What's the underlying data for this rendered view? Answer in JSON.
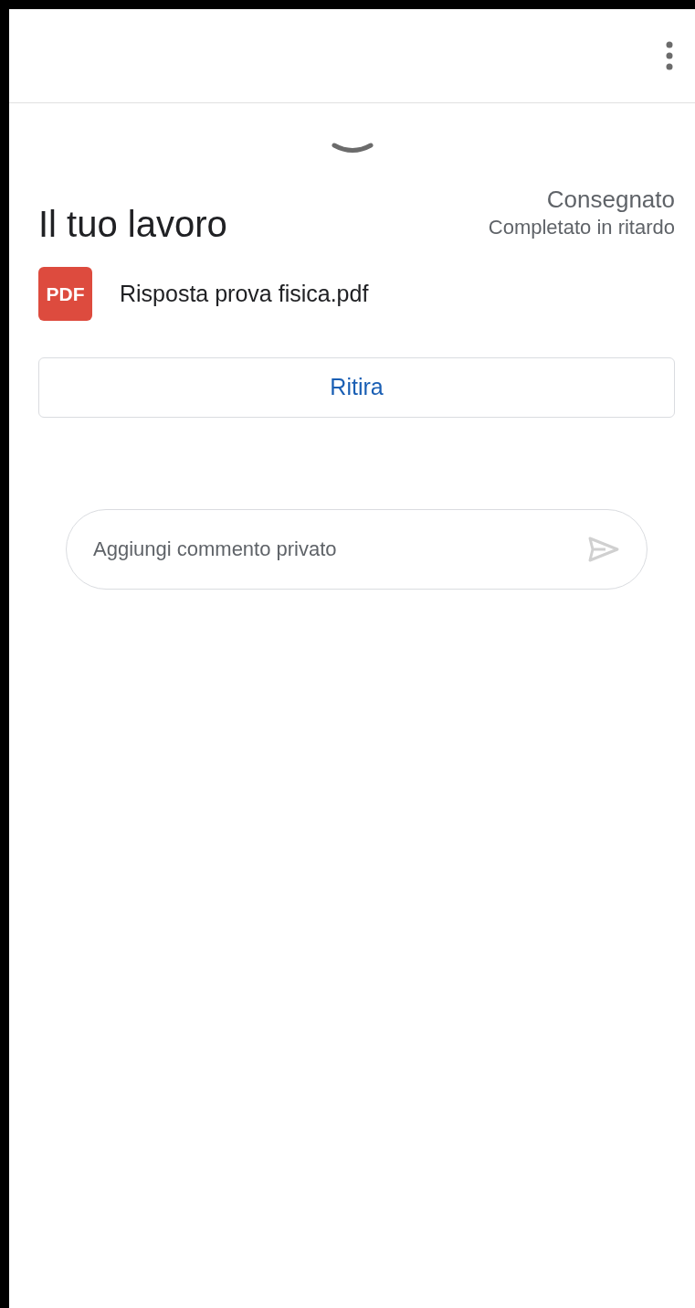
{
  "work": {
    "title": "Il tuo lavoro",
    "status": "Consegnato",
    "substatus": "Completato in ritardo"
  },
  "attachments": [
    {
      "badge": "PDF",
      "name": "Risposta prova fisica.pdf"
    }
  ],
  "unsubmit_button": "Ritira",
  "comment": {
    "placeholder": "Aggiungi commento privato"
  }
}
